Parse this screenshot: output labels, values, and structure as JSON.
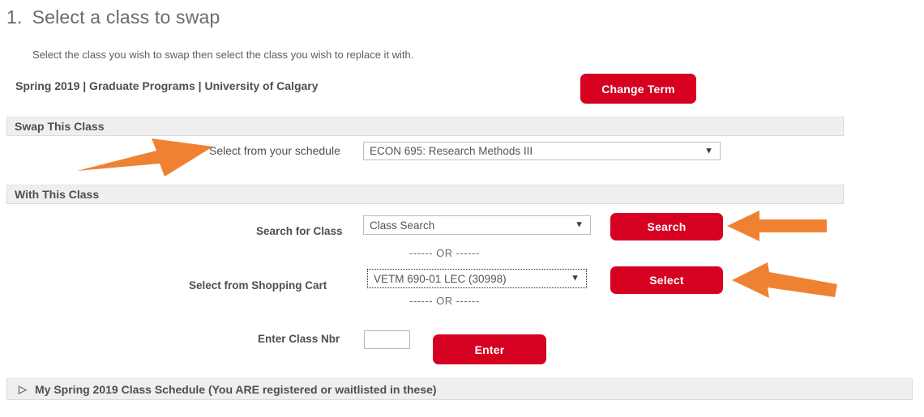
{
  "page": {
    "step_number": "1.",
    "step_title": "Select a class to swap",
    "instruction": "Select the class you wish to swap then select the class you wish to replace it with.",
    "term_line": "Spring 2019 | Graduate Programs | University of Calgary",
    "accent_red": "#d60021",
    "annotation_orange": "#ef8232",
    "section_bar_bg": "#efefef"
  },
  "buttons": {
    "change_term": "Change Term",
    "search": "Search",
    "select": "Select",
    "enter": "Enter"
  },
  "sections": {
    "swap_this_class": "Swap This Class",
    "with_this_class": "With This Class",
    "my_schedule": {
      "toggle_icon": "collapsed-triangle-icon",
      "toggle_glyph": "▷",
      "label": "My Spring 2019 Class Schedule (You ARE registered or waitlisted in these)"
    }
  },
  "form": {
    "schedule": {
      "label": "Select from your schedule",
      "value": "ECON 695: Research Methods III",
      "caret": "▼"
    },
    "search_for_class": {
      "label": "Search for Class",
      "value": "Class Search",
      "caret": "▼"
    },
    "shopping_cart": {
      "label": "Select from Shopping Cart",
      "value": "VETM 690-01 LEC (30998)",
      "caret": "▼"
    },
    "class_nbr": {
      "label": "Enter Class Nbr",
      "value": "",
      "placeholder": ""
    },
    "or_separator": "------ OR ------"
  },
  "annotations": {
    "arrow_to_schedule": "arrow-right-icon",
    "arrow_to_search": "arrow-left-icon",
    "arrow_to_select": "arrow-left-icon"
  }
}
